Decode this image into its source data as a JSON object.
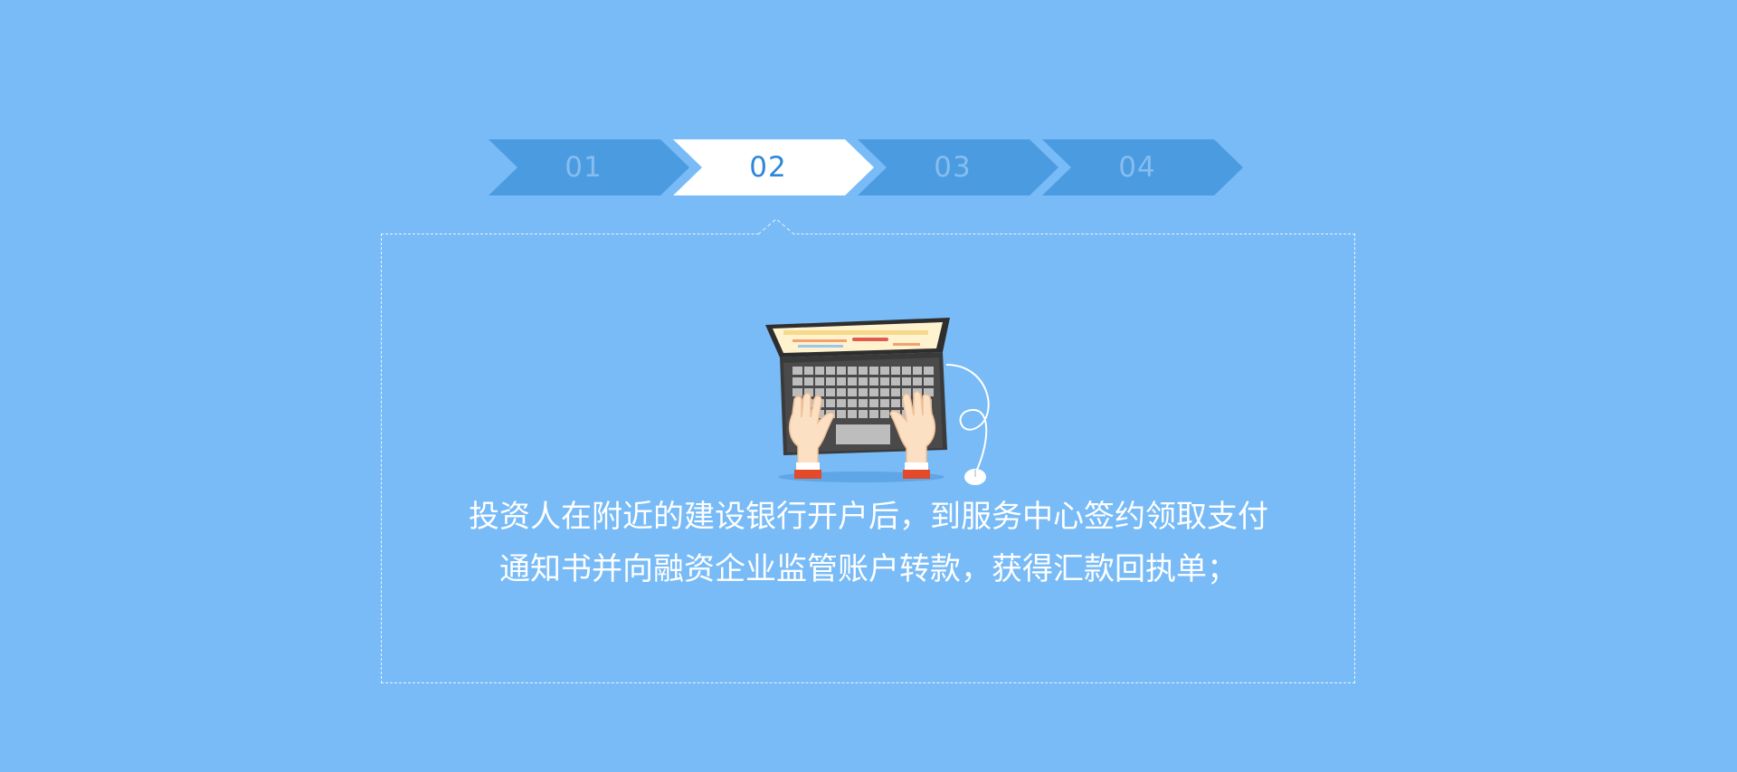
{
  "stepper": {
    "steps": [
      {
        "label": "01",
        "active": false
      },
      {
        "label": "02",
        "active": true
      },
      {
        "label": "03",
        "active": false
      },
      {
        "label": "04",
        "active": false
      }
    ],
    "colors": {
      "inactive_fill": "#4B9BE0",
      "active_fill": "#FFFFFF",
      "inactive_text": "#86BDF0",
      "active_text": "#2E87D9"
    }
  },
  "content": {
    "illustration": "laptop-typing-hands-icon",
    "lines": [
      "投资人在附近的建设银行开户后，到服务中心签约领取支付",
      "通知书并向融资企业监管账户转款，获得汇款回执单；"
    ]
  },
  "colors": {
    "background": "#78BBF7",
    "panel_border": "#EAF5FF"
  }
}
